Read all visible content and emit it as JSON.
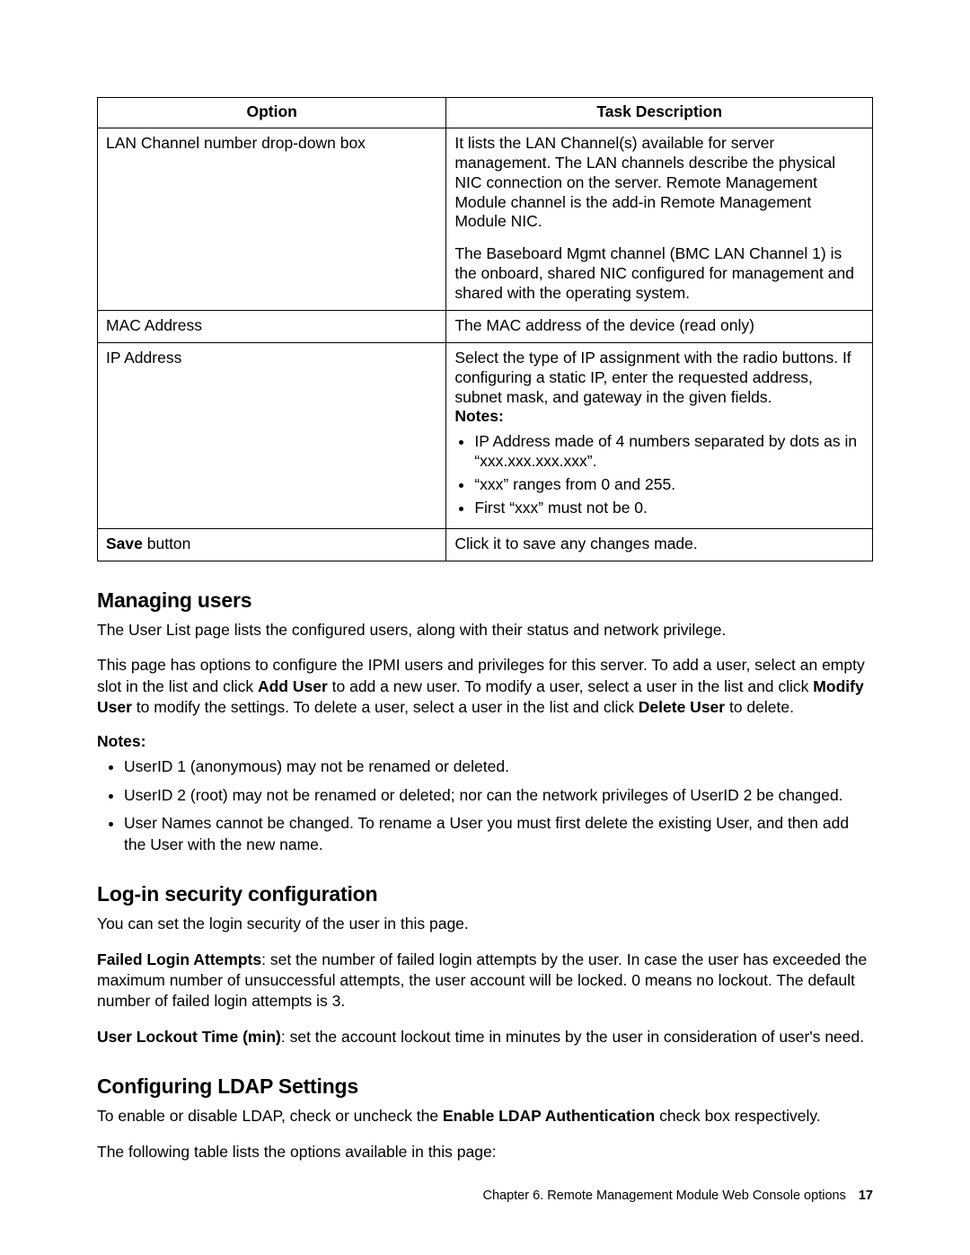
{
  "table": {
    "headers": {
      "option": "Option",
      "task": "Task Description"
    },
    "rows": [
      {
        "option": "LAN Channel number drop-down box",
        "para1": "It lists the LAN Channel(s) available for server management. The LAN channels describe the physical NIC connection on the server. Remote Management Module channel is the add-in Remote Management Module NIC.",
        "para2": "The Baseboard Mgmt channel (BMC LAN Channel 1) is the onboard, shared NIC configured for management and shared with the operating system."
      },
      {
        "option": "MAC Address",
        "para1": "The MAC address of the device (read only)"
      },
      {
        "option": "IP Address",
        "para1": "Select the type of IP assignment with the radio buttons. If configuring a static IP, enter the requested address, subnet mask, and gateway in the given fields.",
        "notes_label": "Notes:",
        "bullets": [
          "IP Address made of 4 numbers separated by dots as in “xxx.xxx.xxx.xxx”.",
          "“xxx” ranges from 0 and 255.",
          "First “xxx” must not be 0."
        ]
      },
      {
        "option_bold": "Save",
        "option_rest": " button",
        "para1": "Click it to save any changes made."
      }
    ]
  },
  "sections": {
    "managing_users": {
      "heading": "Managing users",
      "p1": "The User List page lists the configured users, along with their status and network privilege.",
      "p2_pre": "This page has options to configure the IPMI users and privileges for this server. To add a user, select an empty slot in the list and click ",
      "p2_b1": "Add User",
      "p2_mid1": " to add a new user. To modify a user, select a user in the list and click ",
      "p2_b2": "Modify User",
      "p2_mid2": " to modify the settings. To delete a user, select a user in the list and click ",
      "p2_b3": "Delete User",
      "p2_post": " to delete.",
      "notes_label": "Notes:",
      "bullets": [
        "UserID 1 (anonymous) may not be renamed or deleted.",
        "UserID 2 (root) may not be renamed or deleted; nor can the network privileges of UserID 2 be changed.",
        "User Names cannot be changed. To rename a User you must first delete the existing User, and then add the User with the new name."
      ]
    },
    "login_security": {
      "heading": "Log-in security configuration",
      "p1": "You can set the login security of the user in this page.",
      "p2_b": "Failed Login Attempts",
      "p2_rest": ": set the number of failed login attempts by the user. In case the user has exceeded the maximum number of unsuccessful attempts, the user account will be locked. 0 means no lockout. The default number of failed login attempts is 3.",
      "p3_b": "User Lockout Time (min)",
      "p3_rest": ": set the account lockout time in minutes by the user in consideration of user's need."
    },
    "ldap": {
      "heading": "Configuring LDAP Settings",
      "p1_pre": "To enable or disable LDAP, check or uncheck the ",
      "p1_b": "Enable LDAP Authentication",
      "p1_post": " check box respectively.",
      "p2": "The following table lists the options available in this page:"
    }
  },
  "footer": {
    "chapter": "Chapter 6. Remote Management Module Web Console options",
    "page": "17"
  }
}
